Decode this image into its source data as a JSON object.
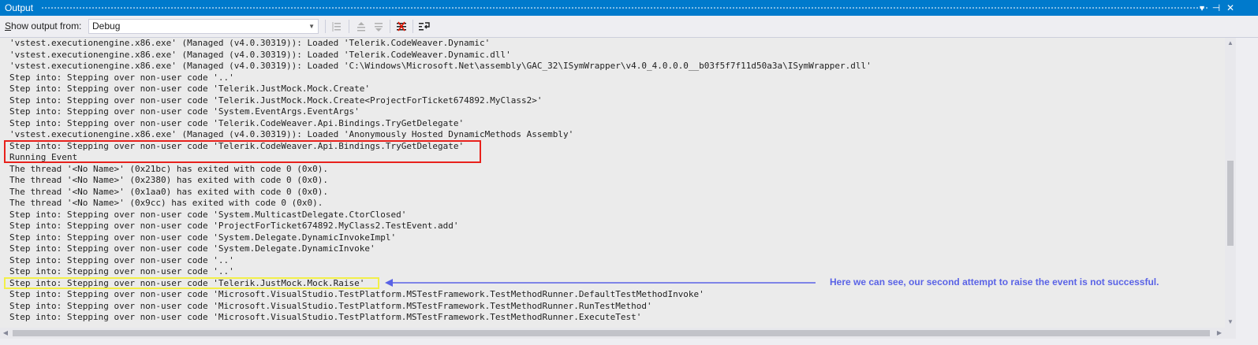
{
  "window": {
    "title": "Output",
    "controls": {
      "dropdown": "▾",
      "pin": "⊣",
      "close": "✕"
    }
  },
  "toolbar": {
    "label_prefix": "S",
    "label_rest": "how output from:",
    "source_selected": "Debug",
    "icons": [
      "find-message-icon",
      "prev-message-icon",
      "next-message-icon",
      "clear-all-icon",
      "toggle-word-wrap-icon"
    ]
  },
  "output": {
    "lines": [
      "'vstest.executionengine.x86.exe' (Managed (v4.0.30319)): Loaded 'Telerik.CodeWeaver.Dynamic'",
      "'vstest.executionengine.x86.exe' (Managed (v4.0.30319)): Loaded 'Telerik.CodeWeaver.Dynamic.dll'",
      "'vstest.executionengine.x86.exe' (Managed (v4.0.30319)): Loaded 'C:\\Windows\\Microsoft.Net\\assembly\\GAC_32\\ISymWrapper\\v4.0_4.0.0.0__b03f5f7f11d50a3a\\ISymWrapper.dll'",
      "Step into: Stepping over non-user code '..'",
      "Step into: Stepping over non-user code 'Telerik.JustMock.Mock.Create'",
      "Step into: Stepping over non-user code 'Telerik.JustMock.Mock.Create<ProjectForTicket674892.MyClass2>'",
      "Step into: Stepping over non-user code 'System.EventArgs.EventArgs'",
      "Step into: Stepping over non-user code 'Telerik.CodeWeaver.Api.Bindings.TryGetDelegate'",
      "'vstest.executionengine.x86.exe' (Managed (v4.0.30319)): Loaded 'Anonymously Hosted DynamicMethods Assembly'",
      "Step into: Stepping over non-user code 'Telerik.CodeWeaver.Api.Bindings.TryGetDelegate'",
      "Running Event",
      "The thread '<No Name>' (0x21bc) has exited with code 0 (0x0).",
      "The thread '<No Name>' (0x2380) has exited with code 0 (0x0).",
      "The thread '<No Name>' (0x1aa0) has exited with code 0 (0x0).",
      "The thread '<No Name>' (0x9cc) has exited with code 0 (0x0).",
      "Step into: Stepping over non-user code 'System.MulticastDelegate.CtorClosed'",
      "Step into: Stepping over non-user code 'ProjectForTicket674892.MyClass2.TestEvent.add'",
      "Step into: Stepping over non-user code 'System.Delegate.DynamicInvokeImpl'",
      "Step into: Stepping over non-user code 'System.Delegate.DynamicInvoke'",
      "Step into: Stepping over non-user code '..'",
      "Step into: Stepping over non-user code '..'",
      "Step into: Stepping over non-user code 'Telerik.JustMock.Mock.Raise'",
      "Step into: Stepping over non-user code 'Microsoft.VisualStudio.TestPlatform.MSTestFramework.TestMethodRunner.DefaultTestMethodInvoke'",
      "Step into: Stepping over non-user code 'Microsoft.VisualStudio.TestPlatform.MSTestFramework.TestMethodRunner.RunTestMethod'",
      "Step into: Stepping over non-user code 'Microsoft.VisualStudio.TestPlatform.MSTestFramework.TestMethodRunner.ExecuteTest'"
    ]
  },
  "annotation": {
    "text": "Here we can see, our second attempt to raise the event is not successful.",
    "color": "#5a63e6"
  },
  "colors": {
    "titlebar": "#007acc",
    "red_box": "#e8211c",
    "yellow_box": "#f2ef4a"
  }
}
